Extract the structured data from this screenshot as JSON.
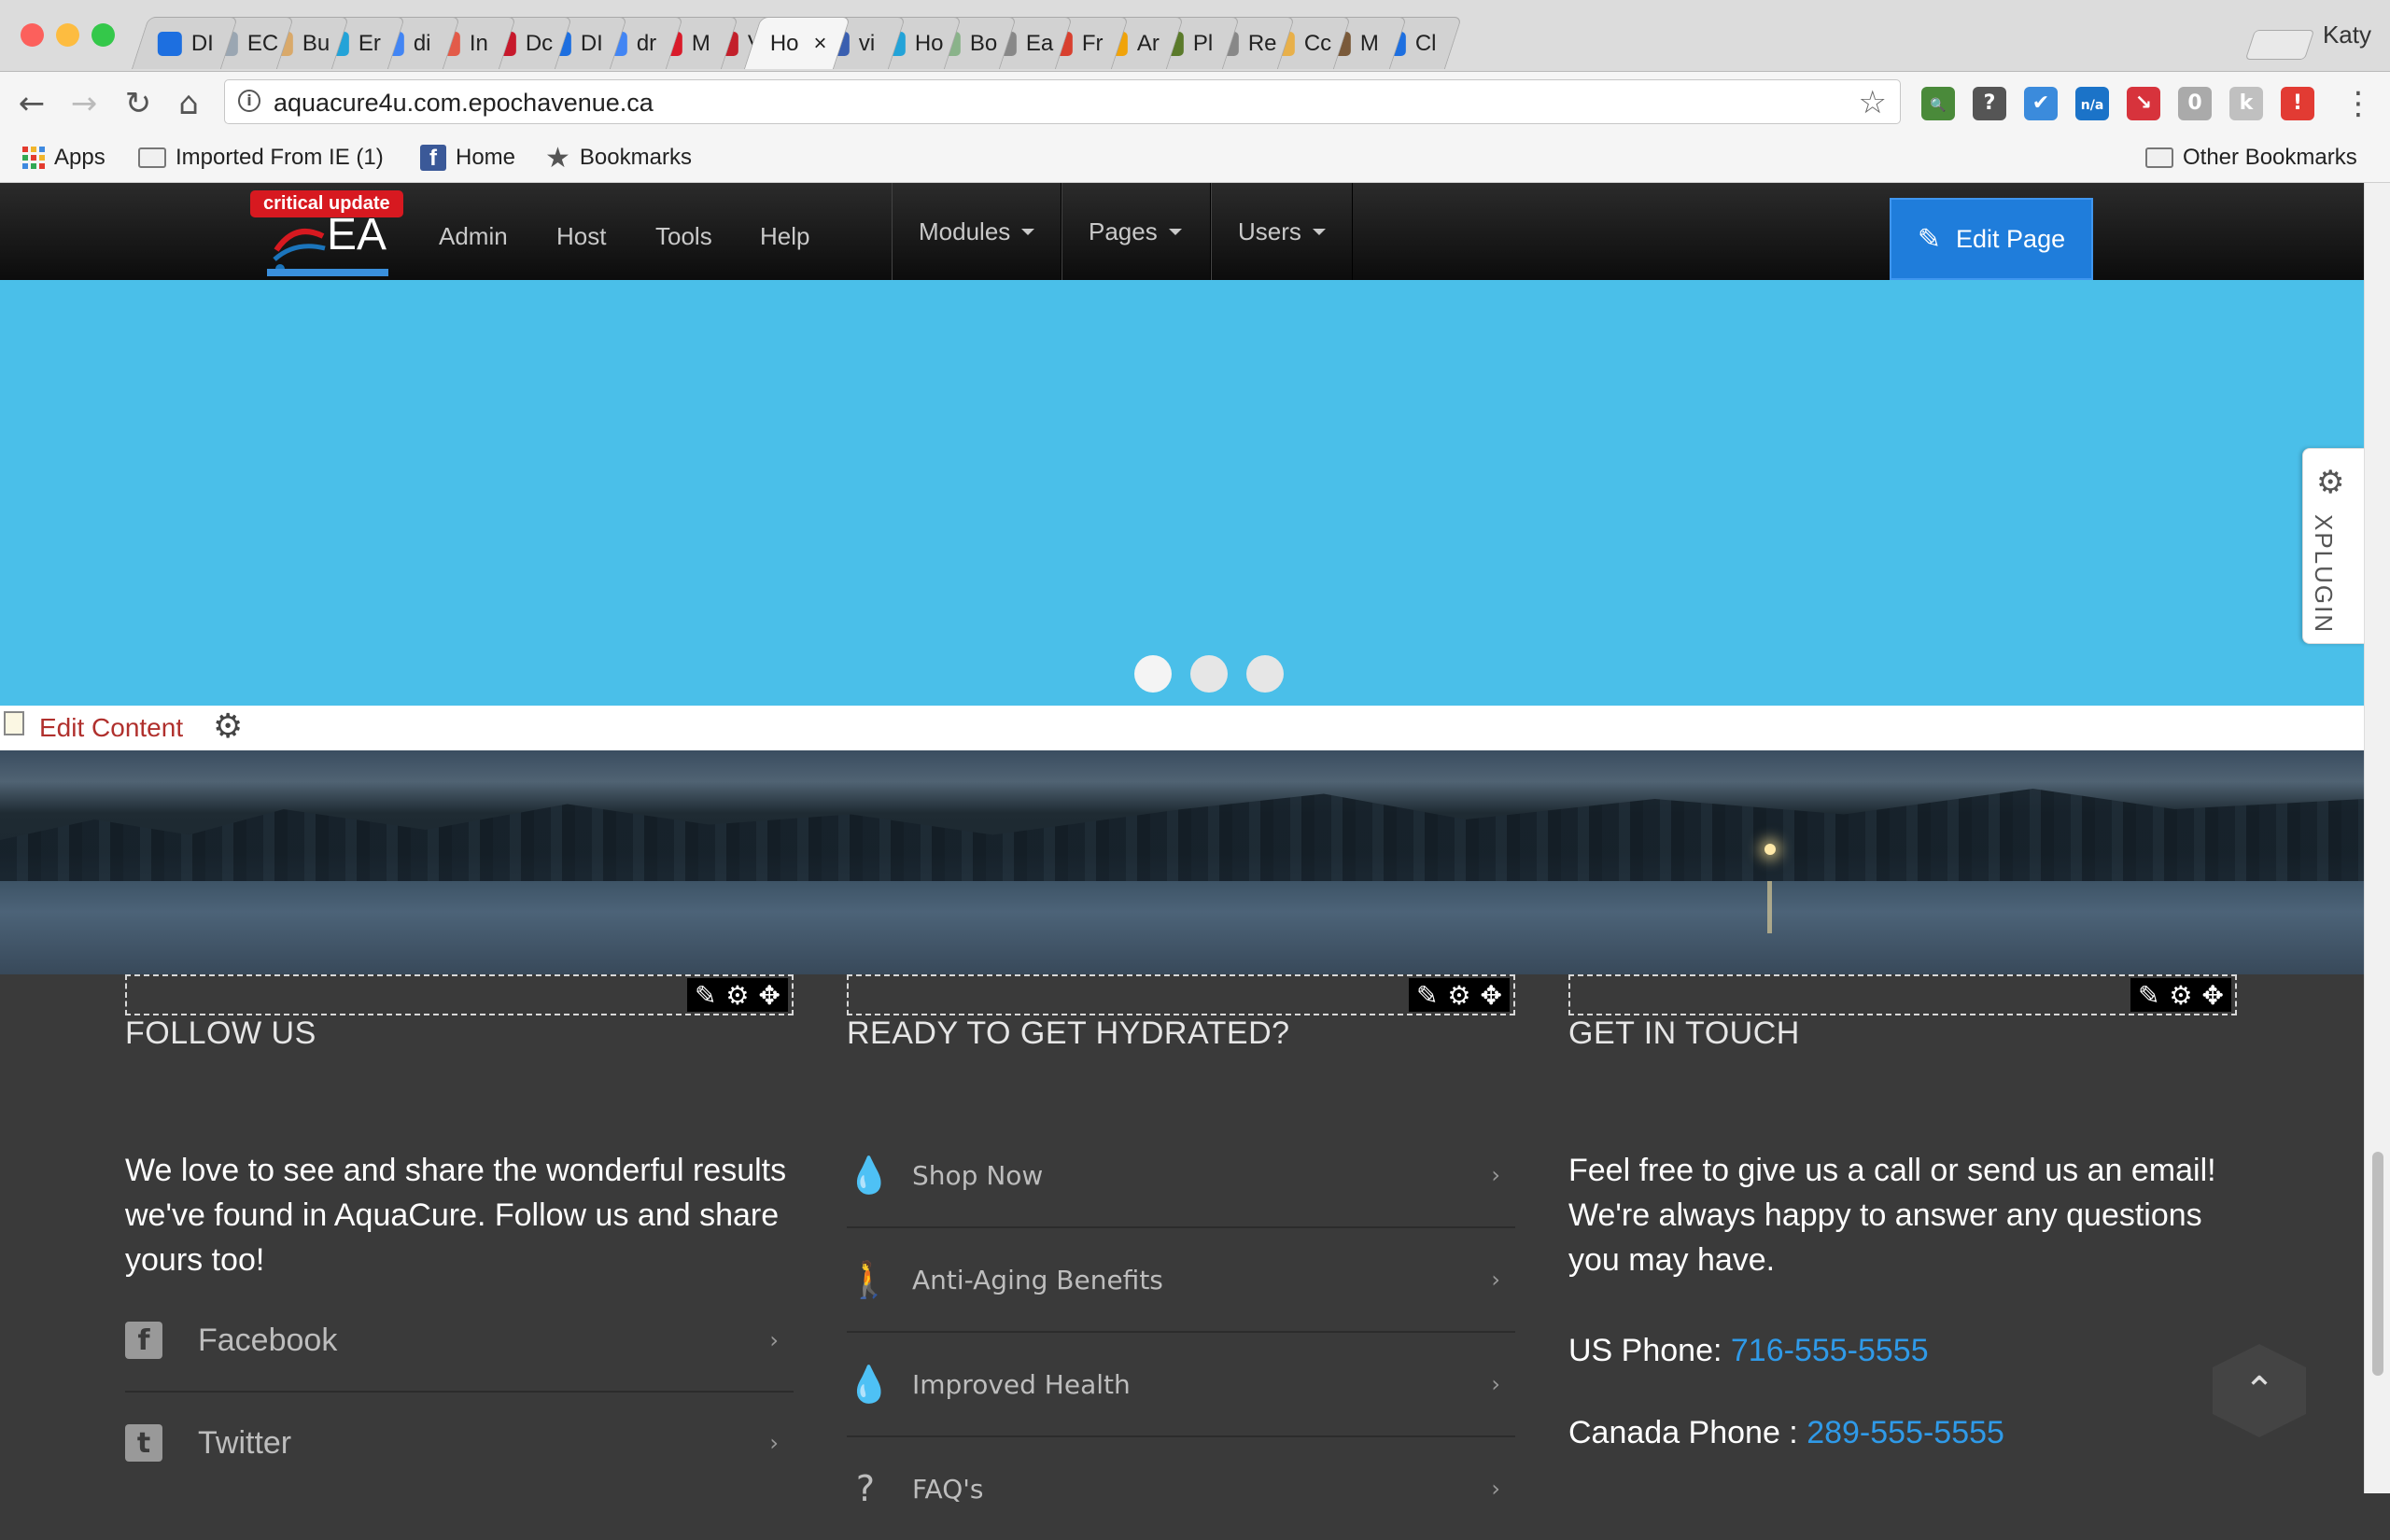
{
  "browser": {
    "tabs": [
      {
        "label": "DI",
        "color": "#1d6fe0"
      },
      {
        "label": "EC",
        "color": "#9aa6b2"
      },
      {
        "label": "Bu",
        "color": "#d9a96a"
      },
      {
        "label": "Er",
        "color": "#23a3d8"
      },
      {
        "label": "di",
        "color": "#4285f4"
      },
      {
        "label": "In",
        "color": "#e35b49"
      },
      {
        "label": "Dc",
        "color": "#c7192c"
      },
      {
        "label": "DI",
        "color": "#1d6fe0"
      },
      {
        "label": "dr",
        "color": "#4285f4"
      },
      {
        "label": "M",
        "color": "#d91b2a"
      },
      {
        "label": "Vi",
        "color": "#c3202b"
      },
      {
        "label": "Ho",
        "color": "#ffffff"
      },
      {
        "label": "vi",
        "color": "#3a5fb0"
      },
      {
        "label": "Ho",
        "color": "#23a3d8"
      },
      {
        "label": "Bo",
        "color": "#8ab38a"
      },
      {
        "label": "Ea",
        "color": "#888888"
      },
      {
        "label": "Fr",
        "color": "#d8402f"
      },
      {
        "label": "Ar",
        "color": "#f0a30a"
      },
      {
        "label": "Pl",
        "color": "#5a7a2a"
      },
      {
        "label": "Re",
        "color": "#888888"
      },
      {
        "label": "Cc",
        "color": "#e8b04a"
      },
      {
        "label": "M",
        "color": "#7a5a3a"
      },
      {
        "label": "Cl",
        "color": "#1d6fe0"
      }
    ],
    "active_tab_close": "×",
    "profile_name": "Katy",
    "nav": {
      "back": "←",
      "forward": "→",
      "reload": "↻",
      "home": "⌂"
    },
    "url_info_icon": "i",
    "url": "aquacure4u.com.epochavenue.ca",
    "bookmark_star": "☆",
    "extensions": [
      {
        "icon": "search-key-icon",
        "color": "#4a8a3a",
        "glyph": "🔍"
      },
      {
        "icon": "paint-roller-icon",
        "color": "#555555",
        "glyph": "?"
      },
      {
        "icon": "checkmark-icon",
        "color": "#3b8bdc",
        "glyph": "✔"
      },
      {
        "icon": "n-a-icon",
        "color": "#1b73c8",
        "glyph": "n/a"
      },
      {
        "icon": "pin-icon",
        "color": "#d7333c",
        "glyph": "↘"
      },
      {
        "icon": "puzzle-icon",
        "color": "#aaaaaa",
        "glyph": "0"
      },
      {
        "icon": "k-icon",
        "color": "#c0c0c0",
        "glyph": "k"
      },
      {
        "icon": "shield-icon",
        "color": "#e23b33",
        "glyph": "!"
      }
    ],
    "menu_icon": "⋮",
    "bookmarks": [
      {
        "label": "Apps",
        "icon": "apps-grid-icon"
      },
      {
        "label": "Imported From IE (1)",
        "icon": "folder-icon"
      },
      {
        "label": "Home",
        "icon": "facebook-icon"
      },
      {
        "label": "Bookmarks",
        "icon": "star-icon"
      }
    ],
    "other_bookmarks": "Other Bookmarks"
  },
  "adminbar": {
    "critical_badge": "critical update",
    "logo_text": "EA",
    "links": [
      "Admin",
      "Host",
      "Tools",
      "Help"
    ],
    "dropdowns": [
      "Modules",
      "Pages",
      "Users"
    ],
    "edit_page": "Edit Page"
  },
  "hero": {
    "slides": 3,
    "active_slide": 1
  },
  "xplugin": {
    "label": "XPLUGIN",
    "gear": "⚙"
  },
  "editstrip": {
    "label": "Edit Content",
    "gear": "⚙"
  },
  "footer": {
    "module_tools": [
      "✎",
      "⚙",
      "✥"
    ],
    "follow": {
      "title": "FOLLOW US",
      "text": "We love to see and share the wonderful results we've found in AquaCure. Follow us and share yours too!",
      "links": [
        {
          "label": "Facebook",
          "glyph": "f"
        },
        {
          "label": "Twitter",
          "glyph": "t"
        }
      ]
    },
    "hydrated": {
      "title": "READY TO GET HYDRATED?",
      "links": [
        {
          "label": "Shop Now",
          "glyph": "💧"
        },
        {
          "label": "Anti-Aging Benefits",
          "glyph": "🚶"
        },
        {
          "label": "Improved Health",
          "glyph": "💧"
        },
        {
          "label": "FAQ's",
          "glyph": "?"
        }
      ]
    },
    "contact": {
      "title": "GET IN TOUCH",
      "text": "Feel free to give us a call or send us an email! We're always happy to answer any questions you may have.",
      "us_label": "US Phone: ",
      "us_phone": "716-555-5555",
      "ca_label": "Canada Phone : ",
      "ca_phone": "289-555-5555"
    },
    "chevron": "›",
    "scroll_top": "⌃"
  }
}
